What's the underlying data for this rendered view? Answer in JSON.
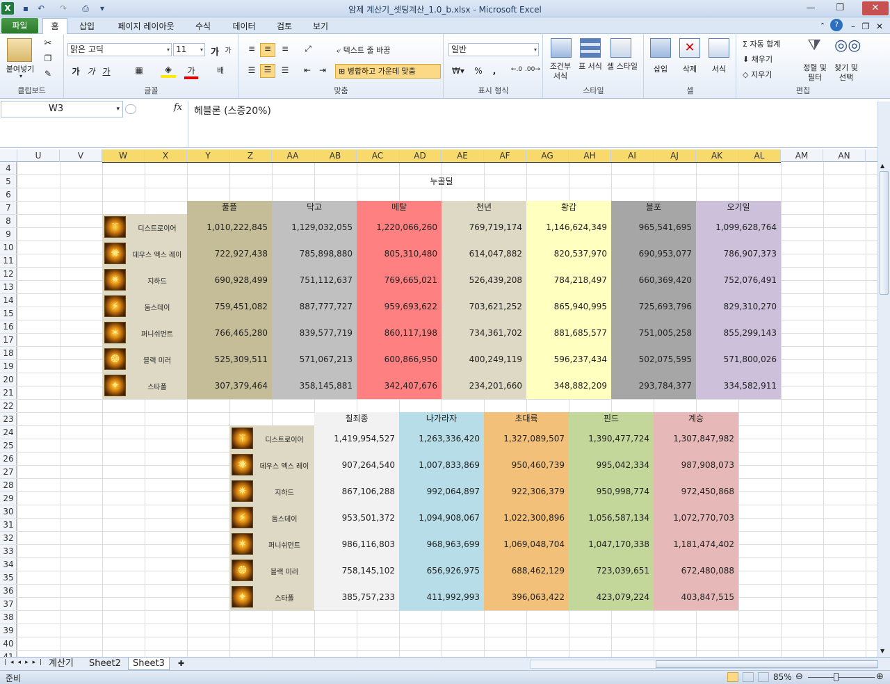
{
  "window": {
    "title": "암제 계산기_셋팅계산_1.0_b.xlsx - Microsoft Excel"
  },
  "tabs": {
    "file": "파일",
    "home": "홈",
    "insert": "삽입",
    "layout": "페이지 레이아웃",
    "formulas": "수식",
    "data": "데이터",
    "review": "검토",
    "view": "보기"
  },
  "ribbon": {
    "paste": "붙여넣기",
    "clipboard": "클립보드",
    "font_name": "맑은 고딕",
    "font_size": "11",
    "font_group": "글꼴",
    "bold": "가",
    "italic": "가",
    "underline": "가",
    "wrap_text": "텍스트 줄 바꿈",
    "merge_center": "병합하고 가운데 맞춤",
    "align_group": "맞춤",
    "number_format": "일반",
    "number_group": "표시 형식",
    "cond_fmt": "조건부 서식",
    "table_fmt": "표 서식",
    "cell_style": "셀 스타일",
    "style_group": "스타일",
    "insert": "삽입",
    "delete": "삭제",
    "format": "서식",
    "cells_group": "셀",
    "autosum": "자동 합계",
    "fill": "채우기",
    "clear": "지우기",
    "sort_filter": "정렬 및 필터",
    "find_select": "찾기 및 선택",
    "edit_group": "편집"
  },
  "formula_bar": {
    "name_box": "W3",
    "fx": "fx",
    "value": "헤블론 (스증20%)"
  },
  "columns": [
    "U",
    "V",
    "W",
    "X",
    "Y",
    "Z",
    "AA",
    "AB",
    "AC",
    "AD",
    "AE",
    "AF",
    "AG",
    "AH",
    "AI",
    "AJ",
    "AK",
    "AL",
    "AM",
    "AN"
  ],
  "rows": [
    "4",
    "5",
    "6",
    "7",
    "8",
    "9",
    "10",
    "11",
    "12",
    "13",
    "14",
    "15",
    "16",
    "17",
    "18",
    "19",
    "20",
    "21",
    "22",
    "23",
    "24",
    "25",
    "26",
    "27",
    "28",
    "29",
    "30",
    "31",
    "32",
    "33",
    "34",
    "35",
    "36",
    "37",
    "38",
    "39",
    "40",
    "41"
  ],
  "sheet": {
    "title": "누골딜",
    "skills": [
      "디스트로이어",
      "데우스 엑스 레이",
      "지하드",
      "둠스데이",
      "퍼니쉬먼트",
      "블랙 미러",
      "스타폴"
    ],
    "table1": {
      "headers": [
        "풀플",
        "닥고",
        "메탈",
        "천년",
        "황갑",
        "블포",
        "오기일"
      ],
      "colors": [
        "#c4bd97",
        "#c0c0c0",
        "#ff8080",
        "#ddd9c4",
        "#ffffc0",
        "#a6a6a6",
        "#ccc0da"
      ],
      "rows": [
        [
          "1,010,222,845",
          "1,129,032,055",
          "1,220,066,260",
          "769,719,174",
          "1,146,624,349",
          "965,541,695",
          "1,099,628,764"
        ],
        [
          "722,927,438",
          "785,898,880",
          "805,310,480",
          "614,047,882",
          "820,537,970",
          "690,953,077",
          "786,907,373"
        ],
        [
          "690,928,499",
          "751,112,637",
          "769,665,021",
          "526,439,208",
          "784,218,497",
          "660,369,420",
          "752,076,491"
        ],
        [
          "759,451,082",
          "887,777,727",
          "959,693,622",
          "703,621,252",
          "865,940,995",
          "725,693,796",
          "829,310,270"
        ],
        [
          "766,465,280",
          "839,577,719",
          "860,117,198",
          "734,361,702",
          "881,685,577",
          "751,005,258",
          "855,299,143"
        ],
        [
          "525,309,511",
          "571,067,213",
          "600,866,950",
          "400,249,119",
          "596,237,434",
          "502,075,595",
          "571,800,026"
        ],
        [
          "307,379,464",
          "358,145,881",
          "342,407,676",
          "234,201,660",
          "348,882,209",
          "293,784,377",
          "334,582,911"
        ]
      ]
    },
    "table2": {
      "headers": [
        "칠죄종",
        "나가라자",
        "초대륙",
        "핀드",
        "계승"
      ],
      "colors": [
        "#f2f2f2",
        "#b7dee8",
        "#f2c078",
        "#c4d79b",
        "#e6b8b7"
      ],
      "rows": [
        [
          "1,419,954,527",
          "1,263,336,420",
          "1,327,089,507",
          "1,390,477,724",
          "1,307,847,982"
        ],
        [
          "907,264,540",
          "1,007,833,869",
          "950,460,739",
          "995,042,334",
          "987,908,073"
        ],
        [
          "867,106,288",
          "992,064,897",
          "922,306,379",
          "950,998,774",
          "972,450,868"
        ],
        [
          "953,501,372",
          "1,094,908,067",
          "1,022,300,896",
          "1,056,587,134",
          "1,072,770,703"
        ],
        [
          "986,116,803",
          "968,963,699",
          "1,069,048,704",
          "1,047,170,338",
          "1,181,474,402"
        ],
        [
          "758,145,102",
          "656,926,975",
          "688,462,129",
          "723,039,651",
          "672,480,088"
        ],
        [
          "385,757,233",
          "411,992,993",
          "396,063,422",
          "423,079,224",
          "403,847,515"
        ]
      ]
    }
  },
  "sheet_tabs": [
    "계산기",
    "Sheet2",
    "Sheet3"
  ],
  "status": {
    "ready": "준비",
    "zoom": "85%"
  }
}
